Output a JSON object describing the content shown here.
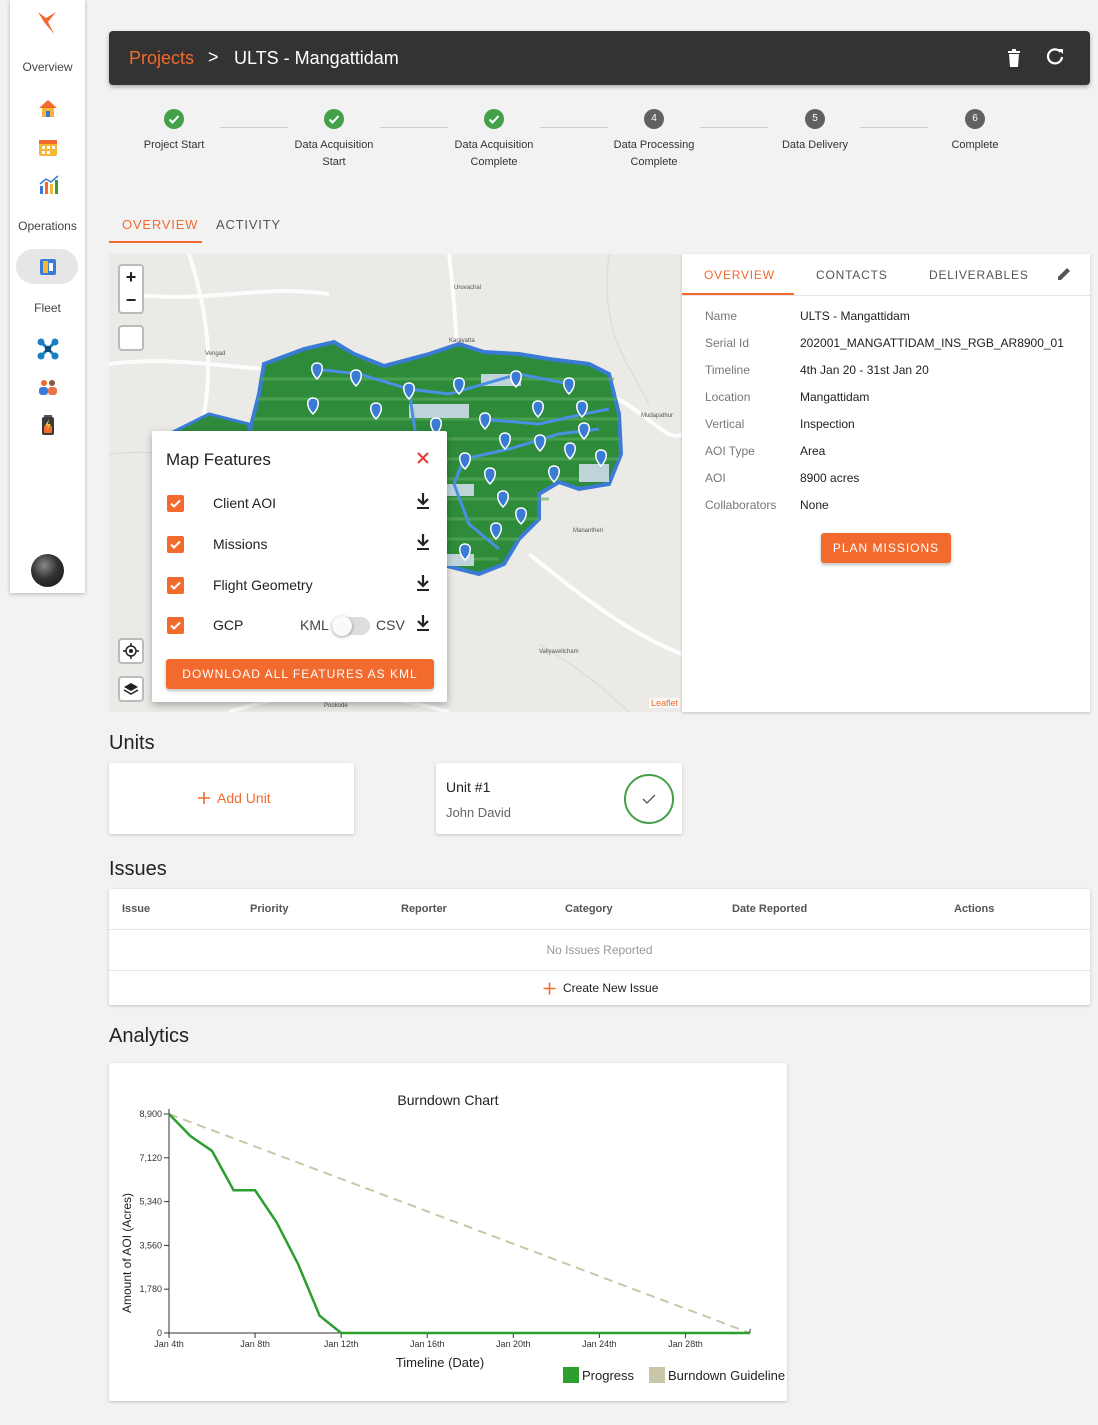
{
  "sidebar": {
    "sections": [
      {
        "label": "Overview"
      },
      {
        "label": "Operations"
      },
      {
        "label": "Fleet"
      }
    ],
    "icons": [
      "logo-icon",
      "home-icon",
      "calendar-icon",
      "analytics-icon",
      "operations-icon",
      "drone-icon",
      "team-icon",
      "battery-icon",
      "avatar"
    ]
  },
  "header": {
    "breadcrumb_root": "Projects",
    "separator": ">",
    "project_name": "ULTS - Mangattidam"
  },
  "stepper": [
    {
      "label": "Project Start",
      "status": "done",
      "number": ""
    },
    {
      "label": "Data Acquisition Start",
      "status": "done",
      "number": ""
    },
    {
      "label": "Data Acquisition Complete",
      "status": "done",
      "number": ""
    },
    {
      "label": "Data Processing Complete",
      "status": "pending",
      "number": "4"
    },
    {
      "label": "Data Delivery",
      "status": "pending",
      "number": "5"
    },
    {
      "label": "Complete",
      "status": "pending",
      "number": "6"
    }
  ],
  "main_tabs": [
    {
      "label": "OVERVIEW",
      "active": true
    },
    {
      "label": "ACTIVITY",
      "active": false
    }
  ],
  "map": {
    "zoom_in": "+",
    "zoom_out": "−",
    "attribution": "Leaflet",
    "place_labels": [
      "Uruvachal",
      "Karayatta",
      "Vengad",
      "Mudapathur",
      "Manantheri",
      "Valiyavelicham",
      "Pookode"
    ]
  },
  "map_features": {
    "title": "Map Features",
    "items": [
      {
        "label": "Client AOI",
        "checked": true
      },
      {
        "label": "Missions",
        "checked": true
      },
      {
        "label": "Flight Geometry",
        "checked": true
      },
      {
        "label": "GCP",
        "checked": true
      }
    ],
    "format_left": "KML",
    "format_right": "CSV",
    "download_all": "DOWNLOAD ALL FEATURES AS KML"
  },
  "info_panel": {
    "tabs": [
      {
        "label": "OVERVIEW",
        "active": true
      },
      {
        "label": "CONTACTS",
        "active": false
      },
      {
        "label": "DELIVERABLES",
        "active": false
      }
    ],
    "fields": [
      {
        "key": "Name",
        "value": "ULTS - Mangattidam"
      },
      {
        "key": "Serial Id",
        "value": "202001_MANGATTIDAM_INS_RGB_AR8900_01"
      },
      {
        "key": "Timeline",
        "value": "4th Jan 20 - 31st Jan 20"
      },
      {
        "key": "Location",
        "value": "Mangattidam"
      },
      {
        "key": "Vertical",
        "value": "Inspection"
      },
      {
        "key": "AOI Type",
        "value": "Area"
      },
      {
        "key": "AOI",
        "value": "8900 acres"
      },
      {
        "key": "Collaborators",
        "value": "None"
      }
    ],
    "plan_button": "PLAN MISSIONS"
  },
  "units": {
    "title": "Units",
    "add_label": "Add Unit",
    "items": [
      {
        "name": "Unit #1",
        "person": "John David"
      }
    ]
  },
  "issues": {
    "title": "Issues",
    "columns": [
      "Issue",
      "Priority",
      "Reporter",
      "Category",
      "Date Reported",
      "Actions"
    ],
    "empty_text": "No Issues Reported",
    "create_label": "Create New Issue"
  },
  "analytics": {
    "title": "Analytics"
  },
  "chart_data": {
    "type": "line",
    "title": "Burndown Chart",
    "xlabel": "Timeline (Date)",
    "ylabel": "Amount of AOI (Acres)",
    "x_ticks": [
      "Jan 4th",
      "Jan 8th",
      "Jan 12th",
      "Jan 16th",
      "Jan 20th",
      "Jan 24th",
      "Jan 28th"
    ],
    "y_ticks": [
      0,
      1780,
      3560,
      5340,
      7120,
      8900
    ],
    "ylim": [
      0,
      8900
    ],
    "xlim_days": [
      4,
      31
    ],
    "series": [
      {
        "name": "Progress",
        "color": "#2e9e2e",
        "x": [
          4,
          5,
          6,
          7,
          8,
          9,
          10,
          11,
          12,
          13,
          31
        ],
        "y": [
          8900,
          8000,
          7400,
          5800,
          5800,
          4500,
          2800,
          700,
          0,
          0,
          0
        ]
      },
      {
        "name": "Burndown Guideline",
        "color": "#c8c8a8",
        "x": [
          4,
          31
        ],
        "y": [
          8900,
          0
        ]
      }
    ],
    "legend": "bottom-right"
  }
}
